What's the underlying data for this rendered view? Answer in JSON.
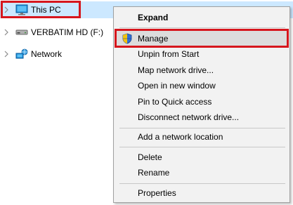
{
  "tree": {
    "items": [
      {
        "label": "This PC",
        "icon": "computer-icon",
        "selected": true
      },
      {
        "label": "VERBATIM HD (F:)",
        "icon": "drive-icon",
        "selected": false
      },
      {
        "label": "Network",
        "icon": "network-icon",
        "selected": false
      }
    ]
  },
  "context_menu": {
    "items": [
      {
        "label": "Expand"
      },
      {
        "label": "Manage"
      },
      {
        "label": "Unpin from Start"
      },
      {
        "label": "Map network drive..."
      },
      {
        "label": "Open in new window"
      },
      {
        "label": "Pin to Quick access"
      },
      {
        "label": "Disconnect network drive..."
      },
      {
        "label": "Add a network location"
      },
      {
        "label": "Delete"
      },
      {
        "label": "Rename"
      },
      {
        "label": "Properties"
      }
    ]
  },
  "colors": {
    "selection": "#cce8ff",
    "highlight_box": "#d6161d",
    "menu_background": "#f2f2f2",
    "menu_hover": "#dcdcdc"
  }
}
